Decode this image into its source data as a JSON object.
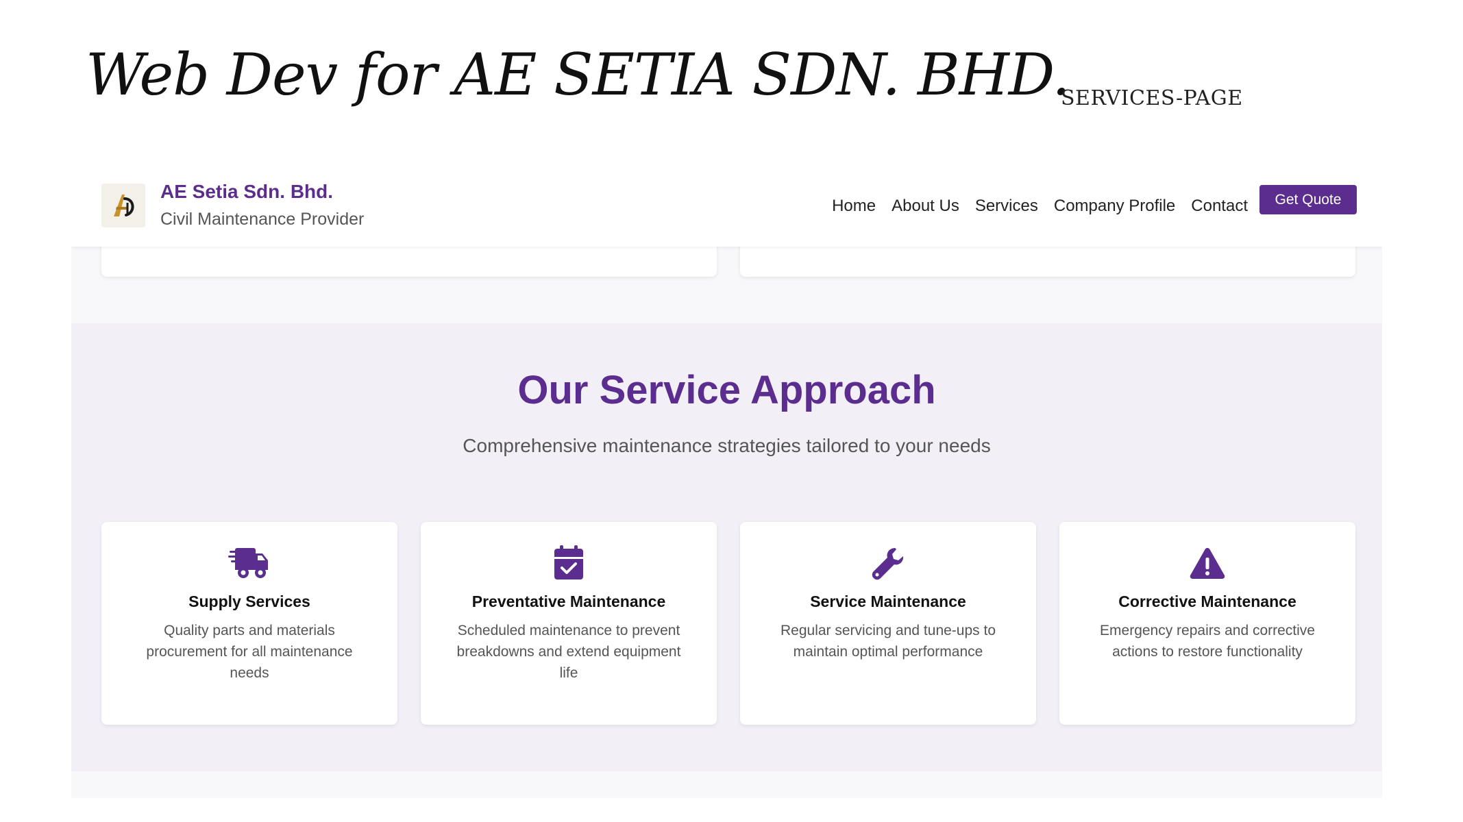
{
  "slide": {
    "title": "Web Dev for AE SETIA SDN. BHD.",
    "tag": "SERVICES-PAGE"
  },
  "site": {
    "brand_name": "AE Setia Sdn. Bhd.",
    "tagline": "Civil Maintenance Provider",
    "nav": [
      {
        "label": "Home"
      },
      {
        "label": "About Us"
      },
      {
        "label": "Services"
      },
      {
        "label": "Company Profile"
      },
      {
        "label": "Contact"
      }
    ],
    "cta_label": "Get Quote"
  },
  "approach": {
    "title": "Our Service Approach",
    "subtitle": "Comprehensive maintenance strategies tailored to your needs",
    "cards": [
      {
        "icon": "truck-icon",
        "title": "Supply Services",
        "description": "Quality parts and materials procurement for all maintenance needs"
      },
      {
        "icon": "calendar-check-icon",
        "title": "Preventative Maintenance",
        "description": "Scheduled maintenance to prevent breakdowns and extend equipment life"
      },
      {
        "icon": "wrench-icon",
        "title": "Service Maintenance",
        "description": "Regular servicing and tune-ups to maintain optimal performance"
      },
      {
        "icon": "warning-triangle-icon",
        "title": "Corrective Maintenance",
        "description": "Emergency repairs and corrective actions to restore functionality"
      }
    ]
  },
  "colors": {
    "brand": "#5b2d8e",
    "section_bg": "#f2eff7",
    "card_bg": "#ffffff",
    "text_muted": "#555555"
  }
}
